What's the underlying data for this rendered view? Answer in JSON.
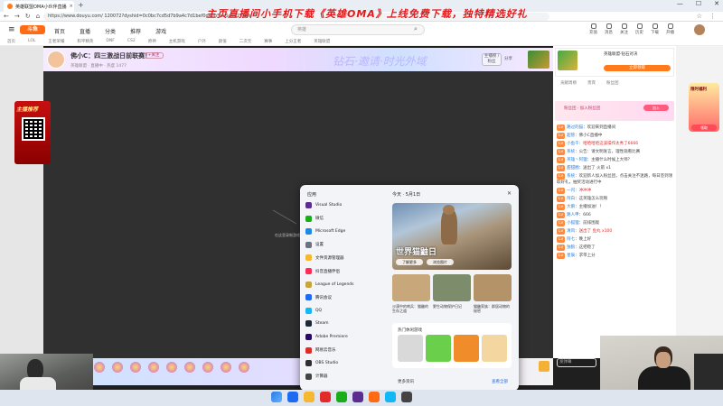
{
  "browser": {
    "tab_title": "英雄联盟OMA小伙伴直播",
    "tab_close": "×",
    "new_tab": "+",
    "url": "https://www.douyu.com/ 120072?dyshid=0c0bc7cd5d7b9a4c7d1bef0d4eb5ae5c0019b5e",
    "window_controls": [
      "—",
      "☐",
      "✕"
    ],
    "nav_icons": [
      "←",
      "→",
      "↻",
      "⌂"
    ],
    "addr_right_icons": [
      "☆",
      "⋮"
    ]
  },
  "promo_text": "主页直播间小手机下载《英雄OMA》上线免费下载，独特精选好礼",
  "site": {
    "logo": "斗鱼",
    "nav": [
      "首页",
      "直播",
      "分类",
      "推荐",
      "游戏"
    ],
    "search_placeholder": "英雄",
    "header_icons": [
      "充值",
      "消息",
      "关注",
      "历史",
      "下载",
      "开播"
    ],
    "subnav": [
      "首页",
      "LOL",
      "王者荣耀",
      "和平精英",
      "DNF",
      "CS2",
      "原神",
      "主机游戏",
      "户外",
      "颜值",
      "二次元",
      "赛事",
      "上分王者",
      "英雄联盟"
    ]
  },
  "room": {
    "title": "佛小C：四三激战日前联赛！",
    "follow": "+关注",
    "meta": "英雄联盟 · 直播中 · 热度 1477",
    "banner": "钻石·邀请·时光外域",
    "rank": "主播榜 / 粉丝",
    "right_btn": "分享"
  },
  "promo_badge": "主播推荐",
  "video_hint": "在这里录制游戏直播内容",
  "right_panel": {
    "rank_title": "英雄联盟·钻石对决",
    "rank_btn": "立即领取",
    "tabs": [
      "贡献周榜",
      "贵宾",
      "粉丝团"
    ],
    "fans_title": "粉丝团 · 加入粉丝团",
    "fans_btn": "加入",
    "chat_input": "发弹幕"
  },
  "chat": [
    {
      "who": "路过的猫",
      "text": "欢迎来到直播间"
    },
    {
      "who": "超管",
      "text": "佛小C直播中"
    },
    {
      "who": "小鱼干",
      "text": "哈哈哈哈这波操作太秀了6666"
    },
    {
      "who": "系统",
      "text": "公告：请文明发言，理性观看比赛"
    },
    {
      "who": "英雄丶阿狸",
      "text": "主播什么时候上大师？"
    },
    {
      "who": "甜甜圈",
      "text": "送出了 火箭 x1"
    },
    {
      "who": "系统",
      "text": "欢迎新人加入粉丝团，点击关注不迷路，每日签到领取好礼，抽奖活动进行中"
    },
    {
      "who": "一闪",
      "text": "冲冲冲"
    },
    {
      "who": "阿白",
      "text": "这英雄怎么玩啊"
    },
    {
      "who": "大鹅",
      "text": "主播加油！！"
    },
    {
      "who": "路人甲",
      "text": "666"
    },
    {
      "who": "小狐狸",
      "text": "前排围观"
    },
    {
      "who": "清风",
      "text": "送出了 鱼丸 x100"
    },
    {
      "who": "阿七",
      "text": "晚上好"
    },
    {
      "who": "独狼",
      "text": "这把稳了"
    },
    {
      "who": "星辰",
      "text": "求带上分"
    }
  ],
  "float_gift": {
    "label": "限时福利",
    "btn": "领取"
  },
  "start_menu": {
    "apps_title": "应用",
    "apps": [
      {
        "label": "Visual Studio",
        "color": "#5c2d91"
      },
      {
        "label": "微信",
        "color": "#1aad19"
      },
      {
        "label": "Microsoft Edge",
        "color": "#1e88e5"
      },
      {
        "label": "设置",
        "color": "#6b7280"
      },
      {
        "label": "文件资源管理器",
        "color": "#f5b830"
      },
      {
        "label": "抖音直播伴侣",
        "color": "#ff2d55"
      },
      {
        "label": "League of Legends",
        "color": "#c9a33b"
      },
      {
        "label": "腾讯会议",
        "color": "#1d6bf3"
      },
      {
        "label": "QQ",
        "color": "#12b7f5"
      },
      {
        "label": "Steam",
        "color": "#1b2838"
      },
      {
        "label": "Adobe Premiere",
        "color": "#2a0a5e"
      },
      {
        "label": "网易云音乐",
        "color": "#e22a2a"
      },
      {
        "label": "OBS Studio",
        "color": "#302e31"
      },
      {
        "label": "计算器",
        "color": "#444"
      }
    ],
    "today_title": "今天 · 5月1日",
    "close": "✕",
    "hero_title": "世界猫鼬日",
    "hero_btn1": "了解更多",
    "hero_btn2": "浏览图片",
    "thumbs": [
      {
        "caption": "沙漠中的哨兵：猫鼬的生存之道",
        "color": "#c8a77a"
      },
      {
        "caption": "野生动物保护日记",
        "color": "#7d8c6a"
      },
      {
        "caption": "猫鼬家族：群居动物的秘密",
        "color": "#b49368"
      }
    ],
    "games_title": "热门休闲游戏",
    "games": [
      "#d9d9d9",
      "#6ad04c",
      "#f08c2a",
      "#f4d6a0"
    ],
    "more_title": "更多资讯",
    "more_link": "查看全部"
  },
  "taskbar_icons": [
    "#1d6bf3",
    "#f5b830",
    "#e22a2a",
    "#1aad19",
    "#5c2d91",
    "#ff6a12",
    "#12b7f5",
    "#444"
  ],
  "colors": {
    "accent": "#ff6a12",
    "promo_red": "#e0191b"
  }
}
